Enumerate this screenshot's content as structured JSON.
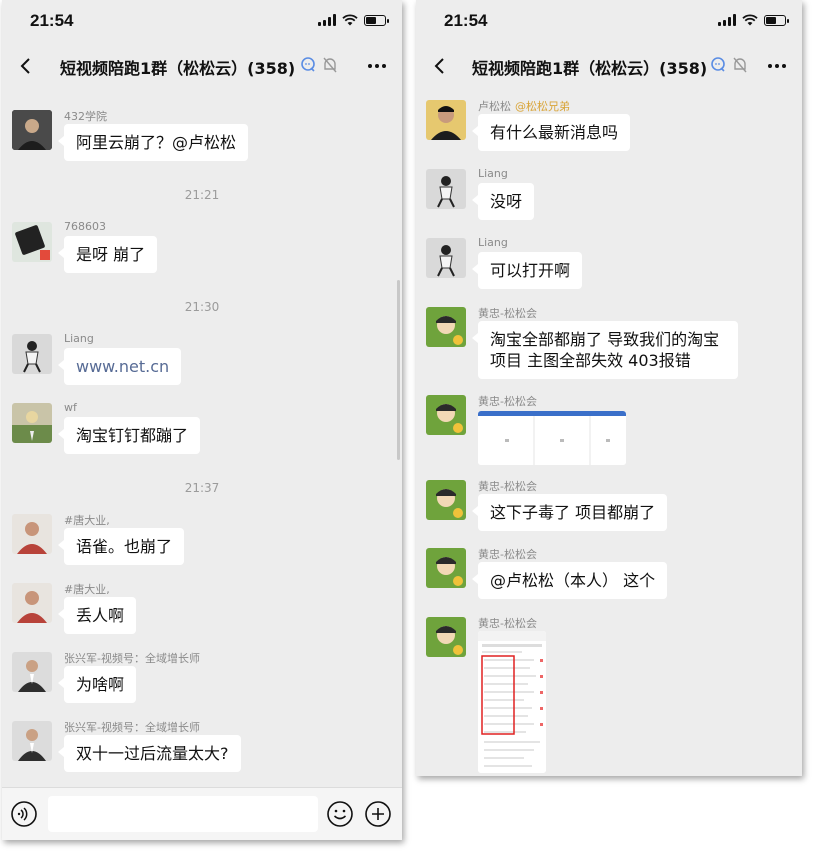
{
  "left": {
    "status": {
      "time": "21:54"
    },
    "nav": {
      "title": "短视频陪跑1群（松松云）(358)"
    },
    "messages": [
      {
        "sender": "432学院",
        "text": "阿里云崩了？@卢松松"
      },
      {
        "sender": "768603",
        "text": "是呀 崩了"
      },
      {
        "sender": "Liang",
        "text": "www.net.cn"
      },
      {
        "sender": "wf",
        "text": "淘宝钉钉都蹦了"
      },
      {
        "sender": "#唐大业,",
        "text": "语雀。也崩了"
      },
      {
        "sender": "#唐大业,",
        "text": "丢人啊"
      },
      {
        "sender": "张兴军-视频号：全域增长师",
        "text": "为啥啊"
      },
      {
        "sender": "张兴军-视频号：全域增长师",
        "text": "双十一过后流量太大?"
      }
    ],
    "timestamps": [
      "21:21",
      "21:30",
      "21:37"
    ]
  },
  "right": {
    "status": {
      "time": "21:54"
    },
    "nav": {
      "title": "短视频陪跑1群（松松云）(358)"
    },
    "messages": [
      {
        "sender": "卢松松",
        "mention": "@松松兄弟",
        "text": "有什么最新消息吗"
      },
      {
        "sender": "Liang",
        "text": "没呀"
      },
      {
        "sender": "Liang",
        "text": "可以打开啊"
      },
      {
        "sender": "黄忠-松松会",
        "text": "淘宝全部都崩了 导致我们的淘宝项目 主图全部失效 403报错"
      },
      {
        "sender": "黄忠-松松会",
        "text": ""
      },
      {
        "sender": "黄忠-松松会",
        "text": "这下子毒了 项目都崩了"
      },
      {
        "sender": "黄忠-松松会",
        "text": "@卢松松（本人） 这个"
      },
      {
        "sender": "黄忠-松松会",
        "text": ""
      }
    ]
  },
  "icons": [
    "back-arrow-icon",
    "speech-bubble-icon",
    "mute-bell-icon",
    "more-dots-icon",
    "voice-icon",
    "emoji-icon",
    "plus-icon",
    "signal-icon",
    "wifi-icon",
    "battery-icon"
  ],
  "colors": {
    "background": "#ededed",
    "bubble": "#ffffff",
    "link": "#576b95",
    "mention": "#d9a437",
    "nav_icon_blue": "#5b8de4"
  }
}
